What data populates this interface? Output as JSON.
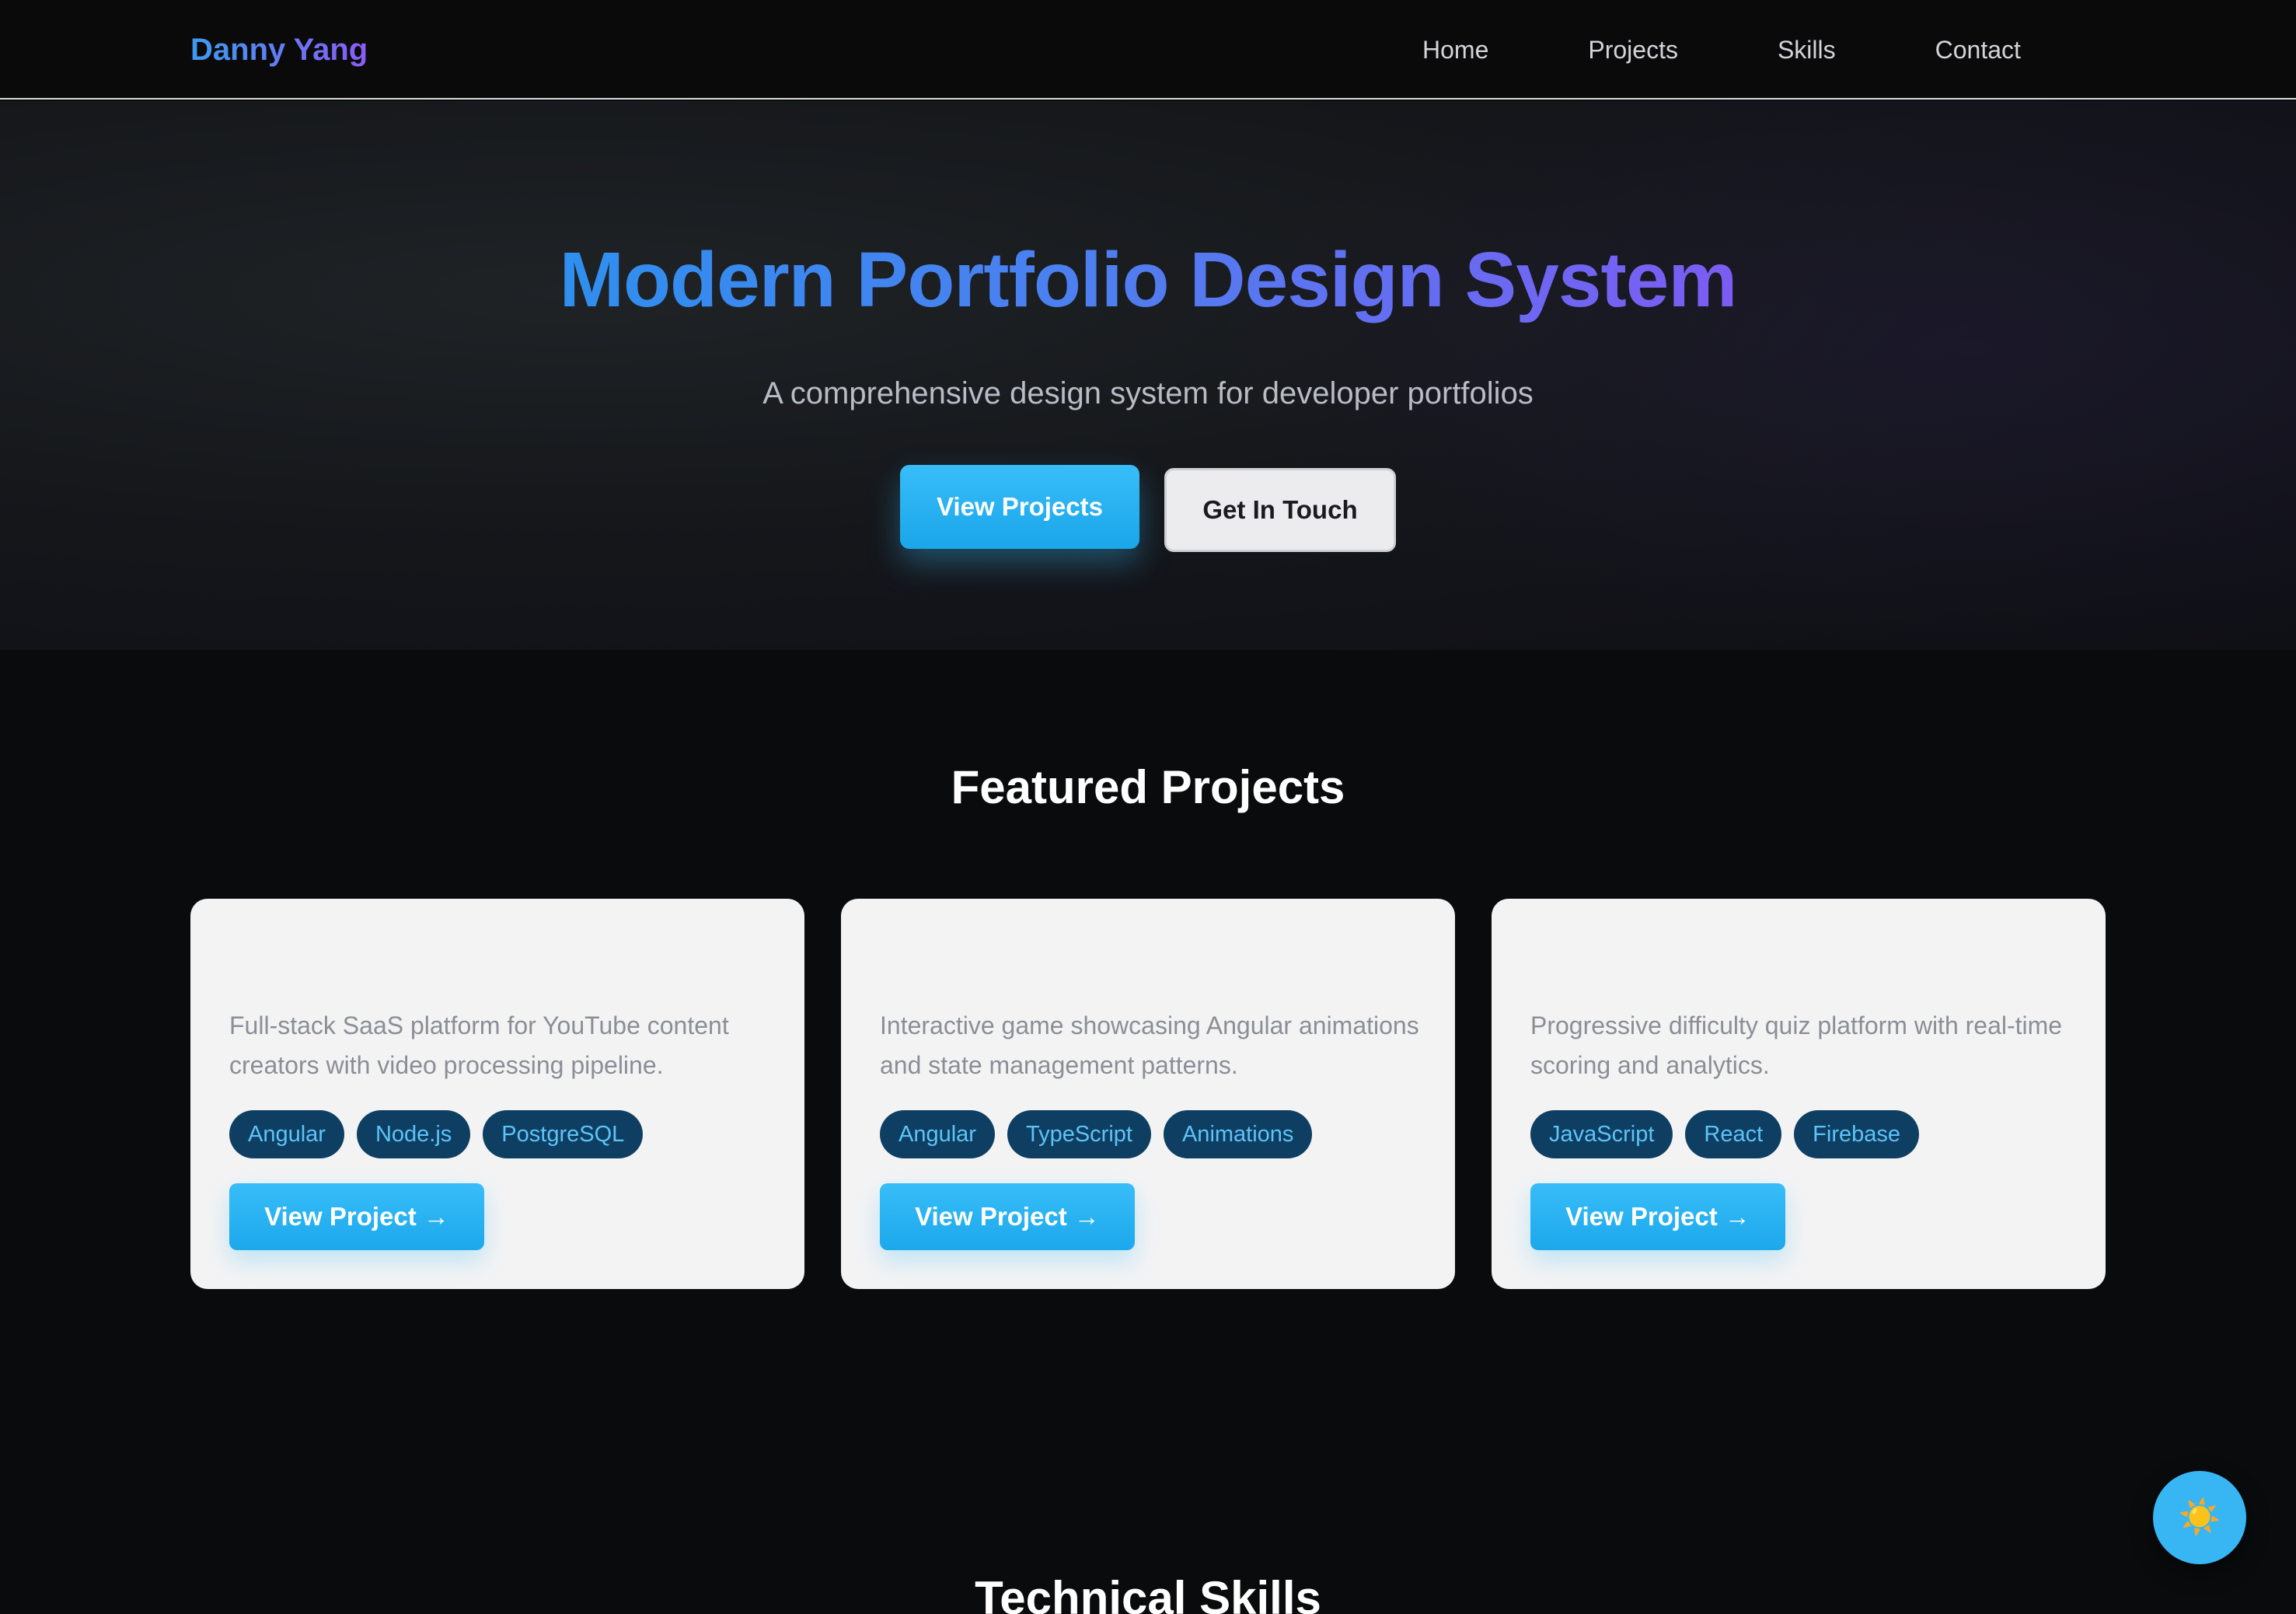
{
  "nav": {
    "brand": "Danny Yang",
    "links": [
      "Home",
      "Projects",
      "Skills",
      "Contact"
    ]
  },
  "hero": {
    "title": "Modern Portfolio Design System",
    "subtitle": "A comprehensive design system for developer portfolios",
    "primary_button": "View Projects",
    "secondary_button": "Get In Touch"
  },
  "featured": {
    "title": "Featured Projects",
    "projects": [
      {
        "description": "Full-stack SaaS platform for YouTube content creators with video processing pipeline.",
        "tags": [
          "Angular",
          "Node.js",
          "PostgreSQL"
        ],
        "button": "View Project →"
      },
      {
        "description": "Interactive game showcasing Angular animations and state management patterns.",
        "tags": [
          "Angular",
          "TypeScript",
          "Animations"
        ],
        "button": "View Project →"
      },
      {
        "description": "Progressive difficulty quiz platform with real-time scoring and analytics.",
        "tags": [
          "JavaScript",
          "React",
          "Firebase"
        ],
        "button": "View Project →"
      }
    ]
  },
  "skills": {
    "title": "Technical Skills"
  },
  "theme_toggle": {
    "icon": "sun-icon",
    "glyph": "☀️"
  },
  "colors": {
    "accent": "#38bdf8",
    "gradient_start": "#2f8fef",
    "gradient_end": "#7c5cf3",
    "tag_bg": "#0e3f63",
    "tag_text": "#5ec3f7"
  }
}
